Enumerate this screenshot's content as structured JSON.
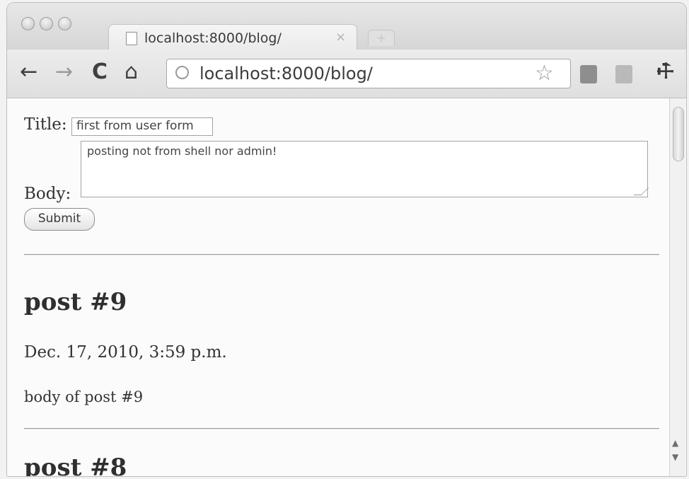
{
  "browser": {
    "tab_title": "localhost:8000/blog/",
    "tab_close": "×",
    "new_tab": "+",
    "url": "localhost:8000/blog/",
    "back_icon": "←",
    "forward_icon": "→",
    "reload_icon": "C",
    "home_icon": "⌂",
    "star_icon": "☆",
    "wrench_icon": "🔧"
  },
  "form": {
    "title_label": "Title:",
    "title_value": "first from user form",
    "body_label": "Body:",
    "body_value": "posting not from shell nor admin!",
    "submit_label": "Submit"
  },
  "posts": [
    {
      "title": "post #9",
      "date": "Dec. 17, 2010, 3:59 p.m.",
      "body": "body of post #9"
    },
    {
      "title": "post #8"
    }
  ],
  "scrollbar": {
    "up_icon": "▲",
    "down_icon": "▼"
  }
}
